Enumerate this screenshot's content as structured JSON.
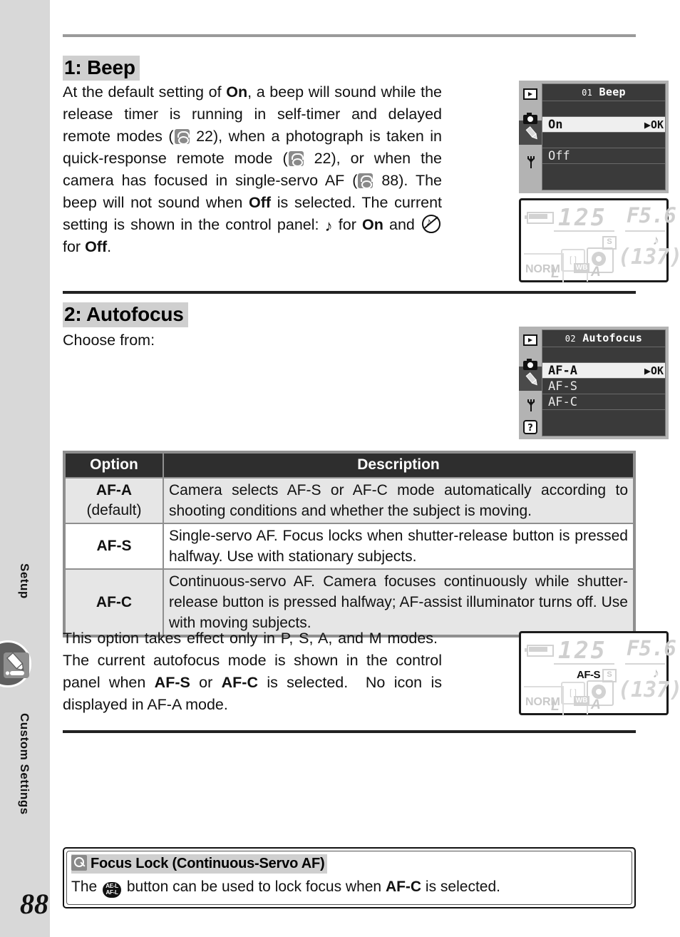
{
  "sidebar": {
    "label_setup": "Setup",
    "label_custom": "Custom Settings",
    "tab_icon": "pencil-icon",
    "page_number": "88"
  },
  "sections": [
    {
      "heading": "1: Beep",
      "paragraph_parts": [
        "At the default setting of ",
        "On",
        ", a beep will sound while the release timer is running in self-timer and delayed remote modes (",
        "22), when a photograph is taken in quick-response remote mode (",
        "22), or when the camera has focused in single-servo AF (",
        "88).  The beep will not sound when ",
        "Off",
        " is selected. The current setting is shown in the control panel: ",
        " for ",
        "On",
        " and ",
        " for ",
        "Off",
        "."
      ],
      "paragraph_plain": "At the default setting of On, a beep will sound while the release timer is running in self-timer and delayed remote modes (22), when a photograph is taken in quick-response remote mode (22), or when the camera has focused in single-servo AF (88).  The beep will not sound when Off is selected. The current setting is shown in the control panel: ♪ for On and ♪-crossed for Off."
    },
    {
      "heading": "2: Autofocus",
      "intro": "Choose from:",
      "after_table": "This option takes effect only in P, S, A, and M modes.  The current autofocus mode is shown in the control panel when AF-S or AF-C is selected.  No icon is displayed in AF-A mode."
    }
  ],
  "menu_beep": {
    "number": "01",
    "title": "Beep",
    "rows": [
      {
        "label": "",
        "highlighted": false,
        "ok": ""
      },
      {
        "label": "On",
        "highlighted": true,
        "ok": "▶OK"
      },
      {
        "label": "",
        "highlighted": false,
        "ok": ""
      },
      {
        "label": "Off",
        "highlighted": false,
        "ok": ""
      },
      {
        "label": "",
        "highlighted": false,
        "ok": ""
      }
    ],
    "tab_icons": [
      "playback-icon",
      "shooting-menu-icon",
      "pencil-icon",
      "wrench-icon"
    ]
  },
  "menu_autofocus": {
    "number": "02",
    "title": "Autofocus",
    "rows": [
      {
        "label": "",
        "highlighted": false,
        "ok": ""
      },
      {
        "label": "AF-A",
        "highlighted": true,
        "ok": "▶OK"
      },
      {
        "label": "AF-S",
        "highlighted": false,
        "ok": ""
      },
      {
        "label": "AF-C",
        "highlighted": false,
        "ok": ""
      },
      {
        "label": "",
        "highlighted": false,
        "ok": ""
      }
    ],
    "tab_icons": [
      "playback-icon",
      "shooting-menu-icon",
      "pencil-icon",
      "wrench-icon",
      "help-icon"
    ]
  },
  "control_panel_beep": {
    "shutter_speed": "125",
    "aperture": "F5.6",
    "frames_remaining": "(137)",
    "quality": "NORM",
    "image_size": "L",
    "white_balance_label": "WB",
    "white_balance_value": "A",
    "focus_area_badge": "S",
    "af_mode": "",
    "beep_indicator": "♪"
  },
  "control_panel_af": {
    "shutter_speed": "125",
    "aperture": "F5.6",
    "frames_remaining": "(137)",
    "quality": "NORM",
    "image_size": "L",
    "white_balance_label": "WB",
    "white_balance_value": "A",
    "focus_area_badge": "S",
    "af_mode": "AF-S",
    "beep_indicator": "♪"
  },
  "table": {
    "headers": [
      "Option",
      "Description"
    ],
    "rows": [
      {
        "option": "AF-A",
        "option_note": "(default)",
        "description": "Camera selects AF-S or AF-C mode automatically according to shooting conditions and whether the subject is moving."
      },
      {
        "option": "AF-S",
        "option_note": "",
        "description": "Single-servo AF.  Focus locks when shutter-release button is pressed halfway.  Use with stationary subjects."
      },
      {
        "option": "AF-C",
        "option_note": "",
        "description": "Continuous-servo AF.  Camera focuses continuously while shutter-release button is pressed halfway; AF-assist illuminator turns off.  Use with moving subjects."
      }
    ]
  },
  "note_box": {
    "title": "Focus Lock (Continuous-Servo AF)",
    "body_before": "The ",
    "body_mid": " button can be used to lock focus when ",
    "body_bold": "AF-C",
    "body_after": " is selected.",
    "icon": "ae-l-af-l-button-icon",
    "title_icon": "magnifier-icon"
  }
}
